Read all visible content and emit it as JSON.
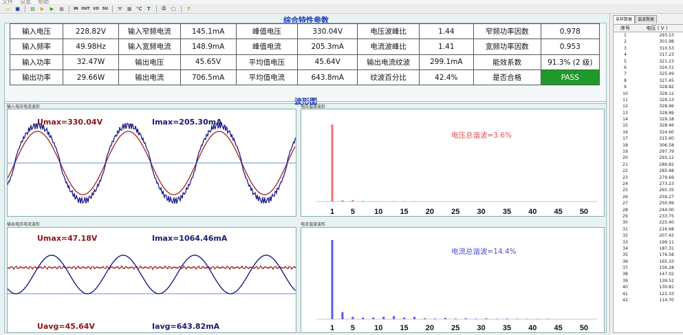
{
  "menu": [
    "文件",
    "设置",
    "帮助"
  ],
  "toolbar": [
    {
      "name": "open-folder-icon",
      "glyph": "▭",
      "color": "#d9a400"
    },
    {
      "name": "save-icon",
      "glyph": "■",
      "color": "#2a4ba8"
    },
    {
      "name": "sep",
      "glyph": "",
      "color": ""
    },
    {
      "name": "export-icon",
      "glyph": "▤",
      "color": "#2e8b2e"
    },
    {
      "name": "next-icon",
      "glyph": "▶",
      "color": "#d9a400"
    },
    {
      "name": "start-icon",
      "glyph": "▶",
      "color": "#1e9e1e"
    },
    {
      "name": "stop-icon",
      "glyph": "■",
      "color": "#999999"
    },
    {
      "name": "sep",
      "glyph": "",
      "color": ""
    },
    {
      "name": "input-icon",
      "glyph": "IN",
      "color": "#333333"
    },
    {
      "name": "output-icon",
      "glyph": "OUT",
      "color": "#333333"
    },
    {
      "name": "io-icon",
      "glyph": "I/O",
      "color": "#333333"
    },
    {
      "name": "su-icon",
      "glyph": "SU",
      "color": "#333333"
    },
    {
      "name": "sep",
      "glyph": "",
      "color": ""
    },
    {
      "name": "tools-icon",
      "glyph": "⚒",
      "color": "#555555"
    },
    {
      "name": "settings-icon",
      "glyph": "▦",
      "color": "#555555"
    },
    {
      "name": "cal-icon",
      "glyph": "℃",
      "color": "#555555"
    },
    {
      "name": "text-icon",
      "glyph": "T",
      "color": "#1e7a1e"
    },
    {
      "name": "sep",
      "glyph": "",
      "color": ""
    },
    {
      "name": "print-icon",
      "glyph": "⎙",
      "color": "#555555"
    },
    {
      "name": "preview-icon",
      "glyph": "▢",
      "color": "#555555"
    },
    {
      "name": "sep",
      "glyph": "",
      "color": ""
    },
    {
      "name": "help-icon",
      "glyph": "?",
      "color": "#c08a00"
    }
  ],
  "params": {
    "title": "综合特性参数",
    "rows": [
      [
        "输入电压",
        "228.82V",
        "输入窄频电流",
        "145.1mA",
        "峰值电压",
        "330.04V",
        "电压波峰比",
        "1.44",
        "窄频功率因数",
        "0.978"
      ],
      [
        "输入频率",
        "49.98Hz",
        "输入宽频电流",
        "148.9mA",
        "峰值电流",
        "205.3mA",
        "电流波峰比",
        "1.41",
        "宽频功率因数",
        "0.953"
      ],
      [
        "输入功率",
        "32.47W",
        "输出电压",
        "45.65V",
        "平均值电压",
        "45.64V",
        "输出电流纹波",
        "299.1mA",
        "能效系数",
        "91.3% (2 级)"
      ],
      [
        "输出功率",
        "29.66W",
        "输出电流",
        "706.5mA",
        "平均值电流",
        "643.8mA",
        "纹波百分比",
        "42.4%",
        "是否合格",
        "PASS"
      ]
    ]
  },
  "waveforms": {
    "title": "波形图",
    "input_wave": {
      "title": "输入电压电流波形",
      "umax": "Umax=330.04V",
      "imax": "Imax=205.30mA",
      "colors": {
        "voltage": "#a02020",
        "current": "#1a1a8c"
      }
    },
    "output_wave": {
      "title": "输出电压电流波形",
      "umax": "Umax=47.18V",
      "imax": "Imax=1064.46mA",
      "uavg": "Uavg=45.64V",
      "iavg": "Iavg=643.82mA",
      "colors": {
        "voltage": "#a02020",
        "current": "#1a1a8c"
      }
    },
    "voltage_harmonic": {
      "title": "电压谐波波形",
      "label": "电压总谐波=3.6%",
      "color": "#f07070",
      "x_ticks": [
        "1",
        "5",
        "10",
        "15",
        "20",
        "25",
        "30",
        "35",
        "40",
        "45",
        "50"
      ],
      "bars": [
        [
          1,
          100
        ],
        [
          3,
          1.6
        ],
        [
          5,
          1.8
        ],
        [
          7,
          0.8
        ],
        [
          9,
          0.5
        ],
        [
          11,
          0.4
        ],
        [
          13,
          0.3
        ],
        [
          15,
          0.3
        ],
        [
          17,
          0.2
        ]
      ]
    },
    "current_harmonic": {
      "title": "电流谐波波形",
      "label": "电流总谐波=14.4%",
      "color": "#5a5ae0",
      "x_ticks": [
        "1",
        "5",
        "10",
        "15",
        "20",
        "25",
        "30",
        "35",
        "40",
        "45",
        "50"
      ],
      "bars": [
        [
          1,
          100
        ],
        [
          3,
          9
        ],
        [
          5,
          3
        ],
        [
          7,
          2
        ],
        [
          9,
          2
        ],
        [
          11,
          3
        ],
        [
          13,
          4
        ],
        [
          15,
          2
        ],
        [
          17,
          3
        ],
        [
          19,
          1.2
        ],
        [
          21,
          0.8
        ],
        [
          23,
          1.5
        ],
        [
          25,
          0.8
        ],
        [
          27,
          1.2
        ],
        [
          29,
          0.6
        ],
        [
          31,
          1
        ],
        [
          33,
          0.5
        ],
        [
          35,
          0.8
        ],
        [
          37,
          0.4
        ],
        [
          39,
          0.5
        ],
        [
          41,
          0.3
        ],
        [
          43,
          0.4
        ]
      ]
    }
  },
  "side": {
    "tabs": [
      "采样数据",
      "谐波数据"
    ],
    "col_headers": [
      "序号",
      "电压 ( V )"
    ],
    "rows": [
      [
        "1",
        "293.53"
      ],
      [
        "2",
        "301.98"
      ],
      [
        "3",
        "310.53"
      ],
      [
        "4",
        "317.23"
      ],
      [
        "5",
        "321.23"
      ],
      [
        "6",
        "324.51"
      ],
      [
        "7",
        "325.49"
      ],
      [
        "8",
        "327.45"
      ],
      [
        "9",
        "328.82"
      ],
      [
        "10",
        "328.12"
      ],
      [
        "11",
        "329.13"
      ],
      [
        "12",
        "328.96"
      ],
      [
        "13",
        "328.89"
      ],
      [
        "14",
        "329.18"
      ],
      [
        "15",
        "328.46"
      ],
      [
        "16",
        "324.60"
      ],
      [
        "17",
        "315.60"
      ],
      [
        "18",
        "306.58"
      ],
      [
        "19",
        "297.79"
      ],
      [
        "20",
        "293.12"
      ],
      [
        "21",
        "289.82"
      ],
      [
        "22",
        "285.68"
      ],
      [
        "23",
        "279.69"
      ],
      [
        "24",
        "273.23"
      ],
      [
        "25",
        "265.35"
      ],
      [
        "26",
        "259.27"
      ],
      [
        "27",
        "250.99"
      ],
      [
        "28",
        "244.00"
      ],
      [
        "29",
        "233.75"
      ],
      [
        "30",
        "225.40"
      ],
      [
        "31",
        "216.68"
      ],
      [
        "32",
        "207.42"
      ],
      [
        "33",
        "199.11"
      ],
      [
        "34",
        "187.31"
      ],
      [
        "35",
        "176.58"
      ],
      [
        "36",
        "165.33"
      ],
      [
        "37",
        "156.28"
      ],
      [
        "38",
        "147.02"
      ],
      [
        "39",
        "139.52"
      ],
      [
        "40",
        "130.81"
      ],
      [
        "41",
        "122.33"
      ],
      [
        "42",
        "114.70"
      ]
    ]
  }
}
